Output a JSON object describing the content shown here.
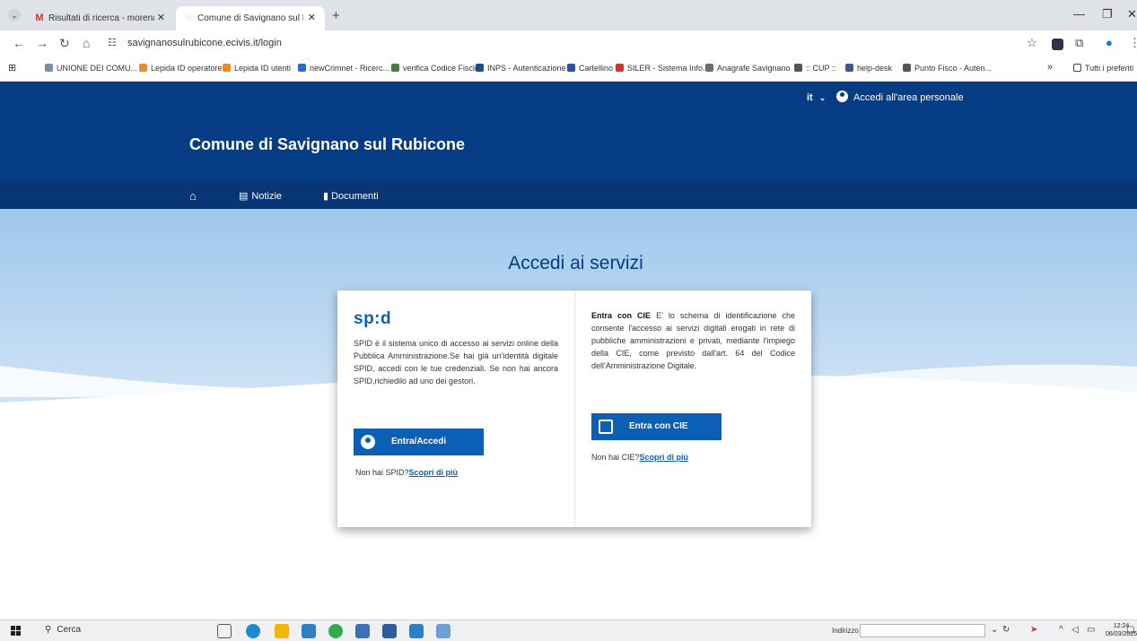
{
  "browser": {
    "tabs": [
      {
        "title": "Risultati di ricerca - morena.mo",
        "icon": "gmail-icon"
      },
      {
        "title": "Comune di Savignano sul Rubi",
        "icon": "site-favicon-icon"
      }
    ],
    "new_tab": "+",
    "url": "savignanosulrubicone.ecivis.it/login",
    "bookmarks": [
      {
        "label": "UNIONE DEI COMU...",
        "color": "#7b8ea8"
      },
      {
        "label": "Lepida ID operatore",
        "color": "#f08a24"
      },
      {
        "label": "Lepida ID utenti",
        "color": "#f08a24"
      },
      {
        "label": "newCrimnet - Ricerc...",
        "color": "#2a6ad1"
      },
      {
        "label": "verifica Codice Fiscle",
        "color": "#4a7a3a"
      },
      {
        "label": "INPS - Autenticazione",
        "color": "#1f4c8f"
      },
      {
        "label": "Cartellino",
        "color": "#2d4f9e"
      },
      {
        "label": "SILER - Sistema Info...",
        "color": "#d2332a"
      },
      {
        "label": "Anagrafe Savignano",
        "color": "#6b6b6b"
      },
      {
        "label": ":: CUP ::",
        "color": "#555555"
      },
      {
        "label": "help-desk",
        "color": "#3b5b8c"
      },
      {
        "label": "Punto Fisco - Auten...",
        "color": "#555555"
      }
    ],
    "bookmarks_overflow": "»",
    "all_bookmarks": "Tutti i preferiti"
  },
  "header": {
    "lang": "it",
    "login_link": "Accedi all'area personale",
    "site_title": "Comune di Savignano sul Rubicone",
    "nav": [
      {
        "label": "Notizie",
        "icon": "newspaper-icon"
      },
      {
        "label": "Documenti",
        "icon": "document-icon"
      }
    ]
  },
  "main": {
    "title": "Accedi ai servizi",
    "spid": {
      "logo": "sp:d",
      "description": "SPID è il sistema unico di accesso ai servizi online della Pubblica Amministrazione.Se hai già un'identità digitale SPID, accedi con le tue credenziali. Se non hai ancora SPID,richiedilo ad uno dei gestori.",
      "button": "Entra/Accedi",
      "more_prefix": "Non hai SPID?",
      "more_link": "Scopri di più"
    },
    "cie": {
      "lead": "Entra con CIE",
      "description": " E' lo schema di identificazione che consente l'accesso ai servizi digitali erogati in rete di pubbliche amministrazioni e privati, mediante l'impiego della CIE, come previsto dall'art. 64 del Codice dell'Amministrazione Digitale.",
      "button": "Entra con CIE",
      "more_prefix": "Non hai CIE?",
      "more_link": "Scopri di più"
    }
  },
  "taskbar": {
    "search": "Cerca",
    "address_label": "Indirizzo",
    "time": "12:24",
    "date": "06/03/2025"
  },
  "colors": {
    "header": "#063c84",
    "accent": "#0b5fb5"
  }
}
